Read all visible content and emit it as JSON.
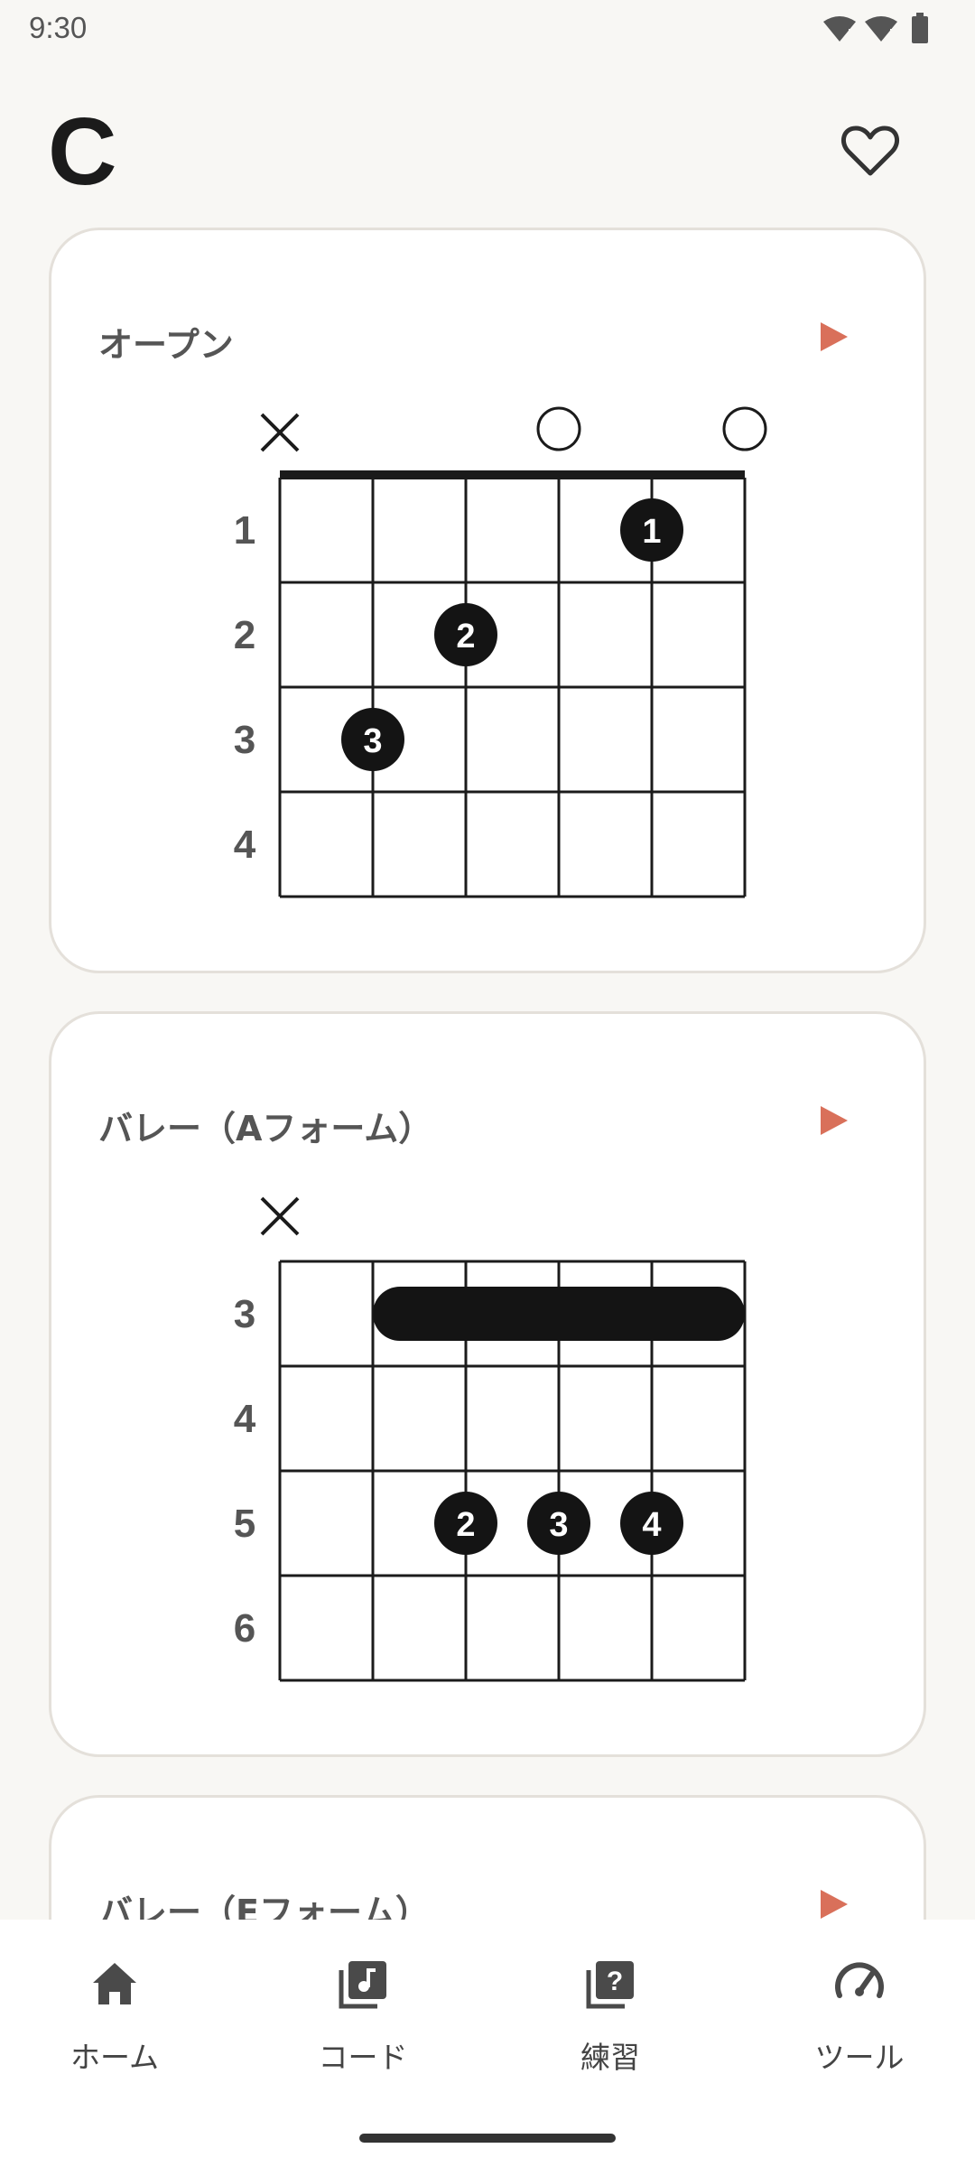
{
  "status": {
    "time": "9:30"
  },
  "header": {
    "title": "C"
  },
  "cards": [
    {
      "title": "オープン",
      "muted_strings": [
        1
      ],
      "open_strings": [
        4,
        6
      ],
      "frets": [
        "1",
        "2",
        "3",
        "4"
      ],
      "fingers": [
        {
          "string": 5,
          "fret": 1,
          "finger": "1"
        },
        {
          "string": 3,
          "fret": 2,
          "finger": "2"
        },
        {
          "string": 2,
          "fret": 3,
          "finger": "3"
        }
      ],
      "barre": null,
      "nut": true
    },
    {
      "title": "バレー（Aフォーム）",
      "muted_strings": [
        1
      ],
      "open_strings": [],
      "frets": [
        "3",
        "4",
        "5",
        "6"
      ],
      "fingers": [
        {
          "string": 3,
          "fret": 3,
          "finger": "2"
        },
        {
          "string": 4,
          "fret": 3,
          "finger": "3"
        },
        {
          "string": 5,
          "fret": 3,
          "finger": "4"
        }
      ],
      "barre": {
        "fret": 1,
        "from": 2,
        "to": 6
      },
      "nut": false
    },
    {
      "title": "バレー（Eフォーム）"
    }
  ],
  "nav": [
    {
      "label": "ホーム",
      "icon": "home-icon"
    },
    {
      "label": "コード",
      "icon": "music-library-icon"
    },
    {
      "label": "練習",
      "icon": "quiz-library-icon"
    },
    {
      "label": "ツール",
      "icon": "speedometer-icon"
    }
  ],
  "colors": {
    "accent": "#d9705a",
    "dot": "#141414",
    "card_border": "#e4e0da"
  }
}
